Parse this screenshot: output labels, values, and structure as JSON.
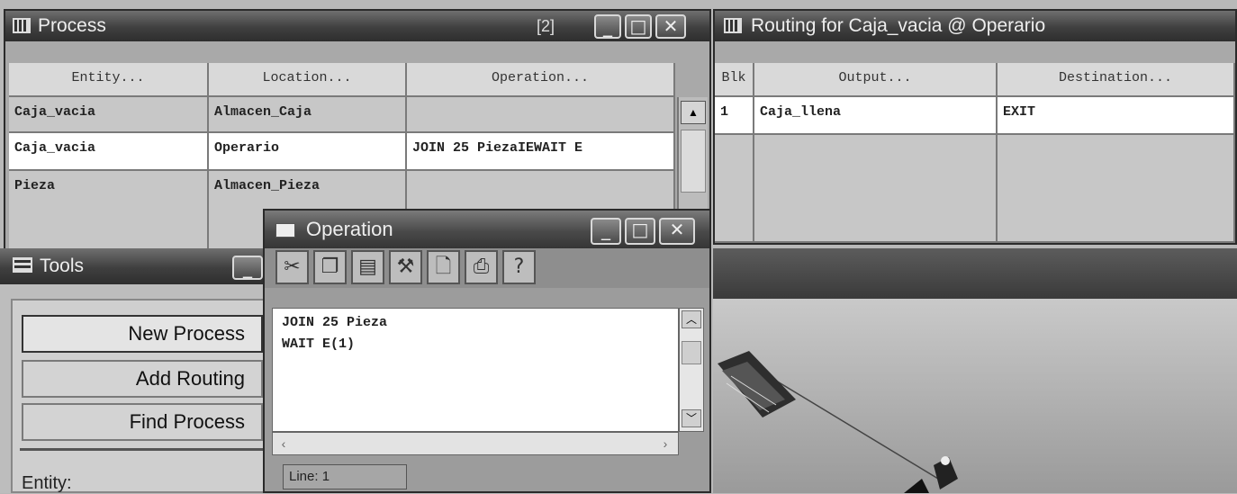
{
  "process_window": {
    "title": "Process",
    "counter": "[2]",
    "columns": [
      "Entity...",
      "Location...",
      "Operation..."
    ],
    "rows": [
      {
        "entity": "Caja_vacia",
        "location": "Almacen_Caja",
        "operation": ""
      },
      {
        "entity": "Caja_vacia",
        "location": "Operario",
        "operation": "JOIN 25 PiezaIEWAIT E"
      },
      {
        "entity": "Pieza",
        "location": "Almacen_Pieza",
        "operation": ""
      }
    ]
  },
  "routing_window": {
    "title": "Routing for Caja_vacia @ Operario",
    "columns": [
      "Blk",
      "Output...",
      "Destination..."
    ],
    "rows": [
      {
        "blk": "1",
        "output": "Caja_llena",
        "destination": "EXIT"
      }
    ]
  },
  "tools_window": {
    "title": "Tools",
    "buttons": [
      "New Process",
      "Add Routing",
      "Find Process"
    ],
    "entity_label": "Entity:"
  },
  "operation_window": {
    "title": "Operation",
    "toolbar": [
      {
        "icon": "cut-icon",
        "glyph": "✂"
      },
      {
        "icon": "copy-icon",
        "glyph": "❐"
      },
      {
        "icon": "paste-icon",
        "glyph": "▤"
      },
      {
        "icon": "build-icon",
        "glyph": "⚒"
      },
      {
        "icon": "document-icon",
        "glyph": "🗋"
      },
      {
        "icon": "print-icon",
        "glyph": "⎙"
      },
      {
        "icon": "help-icon",
        "glyph": "?"
      }
    ],
    "text_lines": [
      "JOIN 25 Pieza",
      "WAIT E(1)"
    ],
    "status": "Line: 1"
  },
  "window_controls": {
    "minimize": "_",
    "maximize": "□",
    "close": "✕"
  }
}
